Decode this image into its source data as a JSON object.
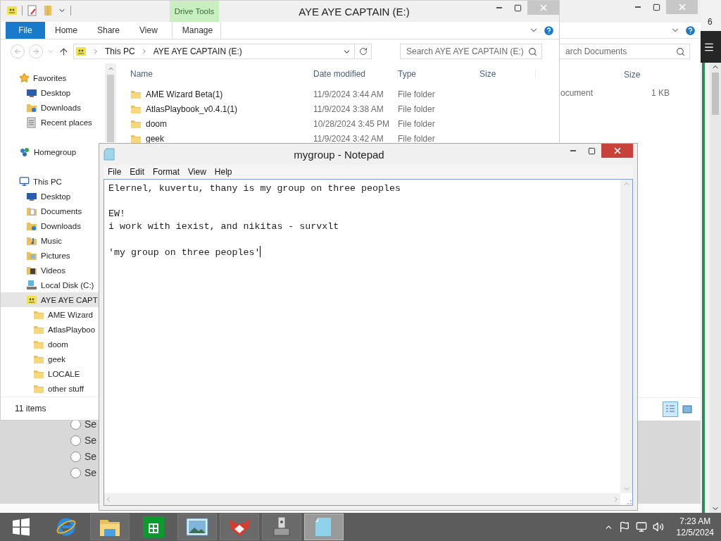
{
  "background_window": {
    "options": [
      {
        "label": "Se",
        "selected": false
      },
      {
        "label": "Se",
        "selected": false
      },
      {
        "label": "Se",
        "selected": false
      },
      {
        "label": "Se",
        "selected": false
      }
    ]
  },
  "right_window": {
    "text": "6"
  },
  "documents_window": {
    "search": {
      "placeholder": "arch Documents"
    },
    "columns": [
      "Size"
    ],
    "rows": [
      {
        "type": "ocument",
        "size": "1 KB"
      }
    ],
    "views": [
      {
        "kind": "details",
        "selected": true
      },
      {
        "kind": "tiles",
        "selected": false
      }
    ]
  },
  "explorer": {
    "title": "AYE AYE CAPTAIN (E:)",
    "context_tab": "Drive Tools",
    "ribbon_tabs": [
      {
        "label": "File",
        "kind": "file"
      },
      {
        "label": "Home",
        "kind": "tab"
      },
      {
        "label": "Share",
        "kind": "tab"
      },
      {
        "label": "View",
        "kind": "tab"
      },
      {
        "label": "Manage",
        "kind": "context"
      }
    ],
    "breadcrumb": [
      "This PC",
      "AYE AYE CAPTAIN (E:)"
    ],
    "search": {
      "placeholder": "Search AYE AYE CAPTAIN (E:)"
    },
    "nav": [
      {
        "label": "Favorites",
        "kind": "favorites",
        "selected": false,
        "children": [
          {
            "label": "Desktop",
            "kind": "desktop",
            "selected": false
          },
          {
            "label": "Downloads",
            "kind": "downloads",
            "selected": false
          },
          {
            "label": "Recent places",
            "kind": "recent",
            "selected": false
          }
        ]
      },
      {
        "label": "Homegroup",
        "kind": "homegroup",
        "selected": false
      },
      {
        "label": "This PC",
        "kind": "pc",
        "selected": false,
        "children": [
          {
            "label": "Desktop",
            "kind": "desktop",
            "selected": false
          },
          {
            "label": "Documents",
            "kind": "documents",
            "selected": false
          },
          {
            "label": "Downloads",
            "kind": "downloads",
            "selected": false
          },
          {
            "label": "Music",
            "kind": "music",
            "selected": false
          },
          {
            "label": "Pictures",
            "kind": "pictures",
            "selected": false
          },
          {
            "label": "Videos",
            "kind": "videos",
            "selected": false
          },
          {
            "label": "Local Disk (C:)",
            "kind": "disk",
            "selected": false
          },
          {
            "label": "AYE AYE CAPT",
            "kind": "drive",
            "selected": true,
            "children": [
              {
                "label": "AME Wizard",
                "kind": "folder",
                "selected": false
              },
              {
                "label": "AtlasPlayboo",
                "kind": "folder",
                "selected": false
              },
              {
                "label": "doom",
                "kind": "folder",
                "selected": false
              },
              {
                "label": "geek",
                "kind": "folder",
                "selected": false
              },
              {
                "label": "LOCALE",
                "kind": "folder",
                "selected": false
              },
              {
                "label": "other stuff",
                "kind": "folder",
                "selected": false
              }
            ]
          }
        ]
      }
    ],
    "columns": [
      "Name",
      "Date modified",
      "Type",
      "Size"
    ],
    "rows": [
      {
        "name": "AME Wizard Beta(1)",
        "date": "11/9/2024 3:44 AM",
        "type": "File folder"
      },
      {
        "name": "AtlasPlaybook_v0.4.1(1)",
        "date": "11/9/2024 3:38 AM",
        "type": "File folder"
      },
      {
        "name": "doom",
        "date": "10/28/2024 3:45 PM",
        "type": "File folder"
      },
      {
        "name": "geek",
        "date": "11/9/2024 3:42 AM",
        "type": "File folder"
      }
    ],
    "status": "11 items"
  },
  "notepad": {
    "title": "mygroup - Notepad",
    "menu": [
      "File",
      "Edit",
      "Format",
      "View",
      "Help"
    ],
    "text": "Elernel, kuvertu, thany is my group on three peoples\n\nEW!\ni work with iexist, and nikitas - survxlt\n\n'my group on three peoples'"
  },
  "taskbar": {
    "apps": [
      {
        "kind": "start",
        "running": false,
        "selected": false
      },
      {
        "kind": "browser",
        "running": false,
        "selected": false
      },
      {
        "kind": "explorer",
        "running": true,
        "selected": false
      },
      {
        "kind": "store",
        "running": false,
        "selected": false
      },
      {
        "kind": "photos",
        "running": true,
        "selected": false
      },
      {
        "kind": "fox",
        "running": true,
        "selected": false
      },
      {
        "kind": "tool",
        "running": true,
        "selected": false
      },
      {
        "kind": "notepad",
        "running": true,
        "selected": true
      }
    ],
    "time": "7:23 AM",
    "date": "12/5/2024"
  }
}
